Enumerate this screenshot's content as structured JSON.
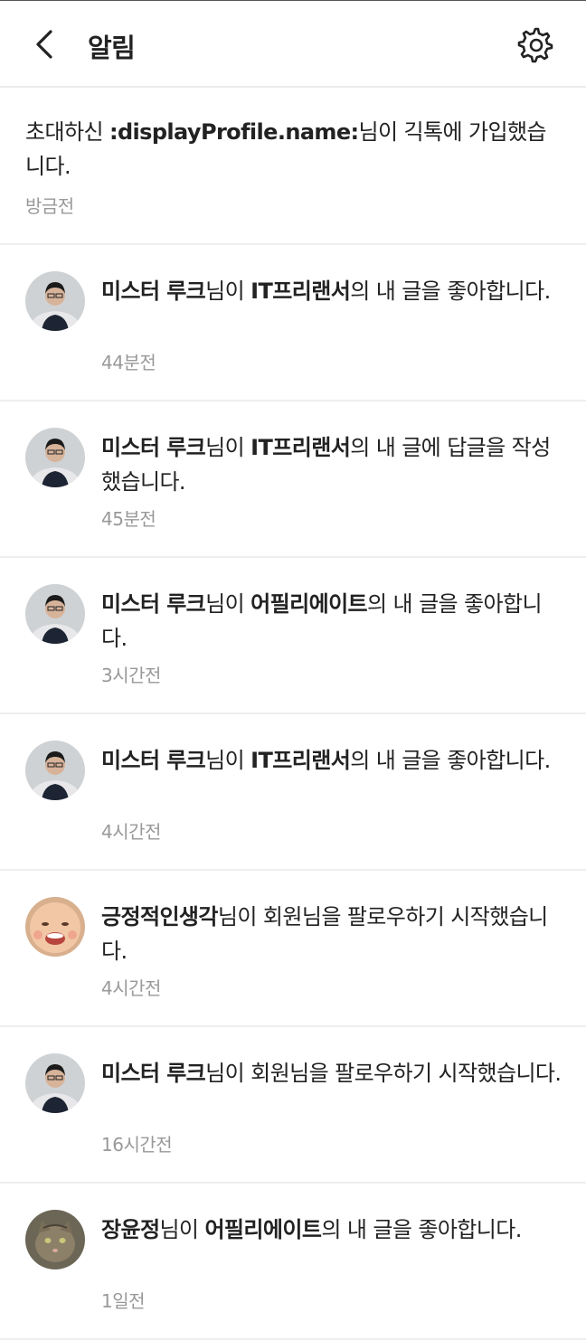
{
  "header": {
    "title": "알림"
  },
  "notifications": [
    {
      "actor": "",
      "pre": "초대하신 ",
      "bold1": ":displayProfile.name:",
      "mid": "님이 긱톡에 가입했습니다.",
      "bold2": "",
      "post": "",
      "time": "방금전",
      "avatar": "none"
    },
    {
      "actor": "미스터 루크",
      "mid": "님이 ",
      "bold2": "IT프리랜서",
      "post": "의 내 글을 좋아합니다.",
      "time": "44분전",
      "avatar": "man"
    },
    {
      "actor": "미스터 루크",
      "mid": "님이 ",
      "bold2": "IT프리랜서",
      "post": "의 내 글에 답글을 작성했습니다.",
      "time": "45분전",
      "avatar": "man"
    },
    {
      "actor": "미스터 루크",
      "mid": "님이 ",
      "bold2": "어필리에이트",
      "post": "의 내 글을 좋아합니다.",
      "time": "3시간전",
      "avatar": "man"
    },
    {
      "actor": "미스터 루크",
      "mid": "님이 ",
      "bold2": "IT프리랜서",
      "post": "의 내 글을 좋아합니다.",
      "time": "4시간전",
      "avatar": "man"
    },
    {
      "actor": "긍정적인생각",
      "mid": "님이 회원님을 팔로우하기 시작했습니다.",
      "bold2": "",
      "post": "",
      "time": "4시간전",
      "avatar": "baby"
    },
    {
      "actor": "미스터 루크",
      "mid": "님이 회원님을 팔로우하기 시작했습니다.",
      "bold2": "",
      "post": "",
      "time": "16시간전",
      "avatar": "man"
    },
    {
      "actor": "장윤정",
      "mid": "님이 ",
      "bold2": "어필리에이트",
      "post": "의 내 글을 좋아합니다.",
      "time": "1일전",
      "avatar": "cat"
    }
  ]
}
